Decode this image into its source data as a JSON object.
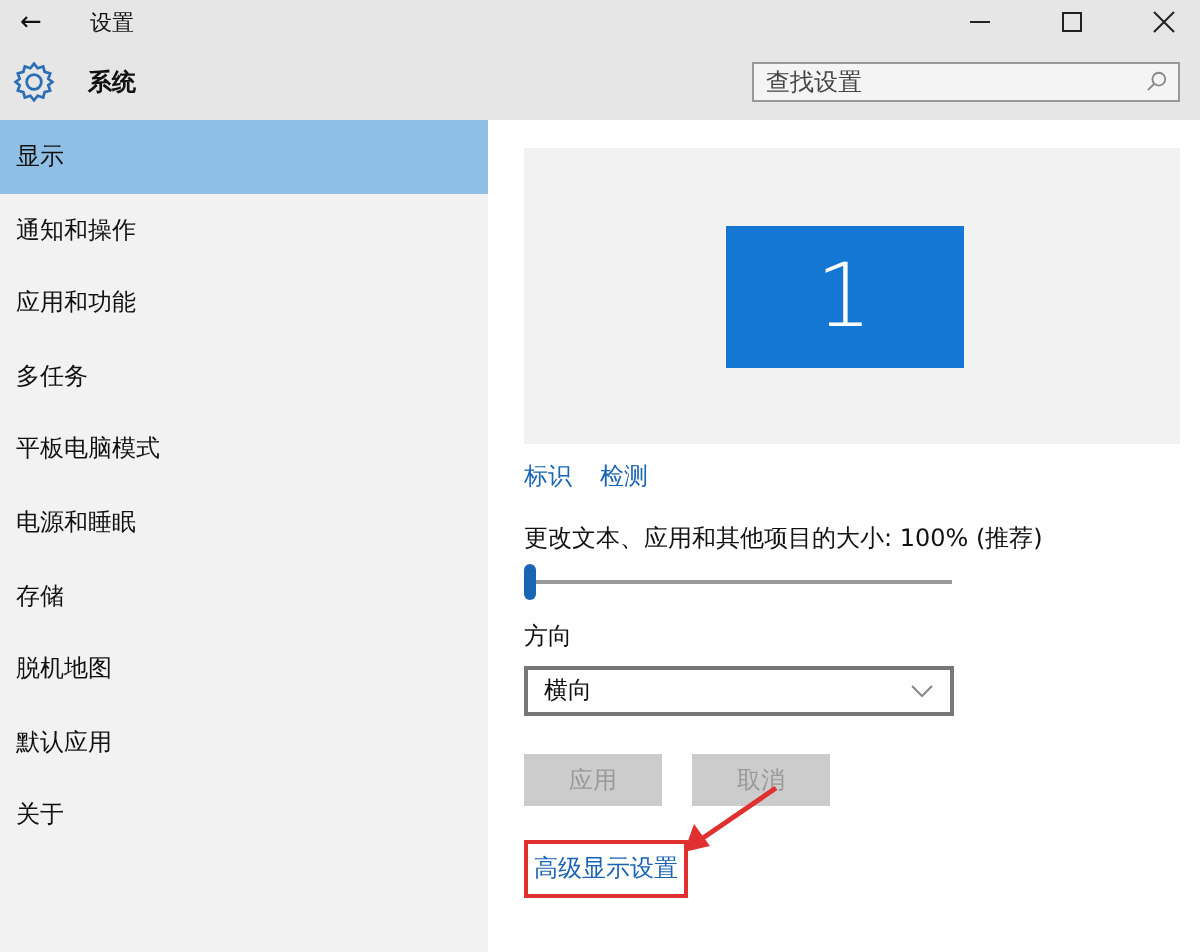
{
  "window": {
    "title": "设置",
    "back": "←"
  },
  "header": {
    "title": "系统",
    "search": {
      "placeholder": "查找设置"
    }
  },
  "sidebar": {
    "items": [
      {
        "label": "显示",
        "selected": true
      },
      {
        "label": "通知和操作",
        "selected": false
      },
      {
        "label": "应用和功能",
        "selected": false
      },
      {
        "label": "多任务",
        "selected": false
      },
      {
        "label": "平板电脑模式",
        "selected": false
      },
      {
        "label": "电源和睡眠",
        "selected": false
      },
      {
        "label": "存储",
        "selected": false
      },
      {
        "label": "脱机地图",
        "selected": false
      },
      {
        "label": "默认应用",
        "selected": false
      },
      {
        "label": "关于",
        "selected": false
      }
    ]
  },
  "display": {
    "monitor": "1",
    "links": [
      "标识",
      "检测"
    ],
    "scale": {
      "label": "更改文本、应用和其他项目的大小: 100% (推荐)",
      "level": 0
    },
    "orientation": {
      "label": "方向",
      "value": "横向"
    },
    "buttons": [
      {
        "label": "应用",
        "disabled": true
      },
      {
        "label": "取消",
        "disabled": true
      }
    ],
    "advanced_link": {
      "label": "高级显示设置",
      "highlighted": true
    }
  }
}
